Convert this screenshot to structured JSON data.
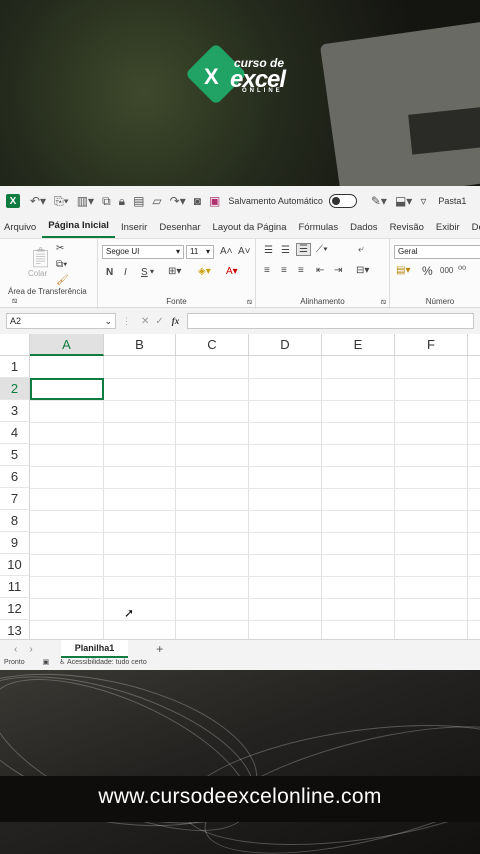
{
  "brand": {
    "logo_letter": "X",
    "line1": "curso de",
    "line2": "excel",
    "line3": "ONLINE"
  },
  "qat": {
    "autosave_label": "Salvamento Automático",
    "book_name": "Pasta1"
  },
  "tabs": [
    "Arquivo",
    "Página Inicial",
    "Inserir",
    "Desenhar",
    "Layout da Página",
    "Fórmulas",
    "Dados",
    "Revisão",
    "Exibir",
    "Desenv"
  ],
  "ribbon": {
    "clipboard": {
      "paste_label": "Colar",
      "group_label": "Área de Transferência"
    },
    "font": {
      "font_name": "Segoe UI",
      "font_size": "11",
      "bold": "N",
      "italic": "I",
      "underline": "S",
      "group_label": "Fonte"
    },
    "alignment": {
      "group_label": "Alinhamento"
    },
    "number": {
      "format": "Geral",
      "percent": "%",
      "thousands": "000",
      "group_label": "Número"
    }
  },
  "formula_bar": {
    "name_box": "A2",
    "fx": "fx",
    "cancel": "✕",
    "enter": "✓"
  },
  "grid": {
    "columns": [
      "A",
      "B",
      "C",
      "D",
      "E",
      "F"
    ],
    "selected_column": "A",
    "rows": [
      "1",
      "2",
      "3",
      "4",
      "5",
      "6",
      "7",
      "8",
      "9",
      "10",
      "11",
      "12",
      "13"
    ],
    "active_cell": "A2"
  },
  "sheet_tabs": {
    "sheets": [
      "Planilha1"
    ],
    "add_label": "+"
  },
  "status": {
    "ready": "Pronto",
    "accessibility": "Acessibilidade: tudo certo"
  },
  "footer": {
    "url": "www.cursodeexcelonline.com"
  }
}
